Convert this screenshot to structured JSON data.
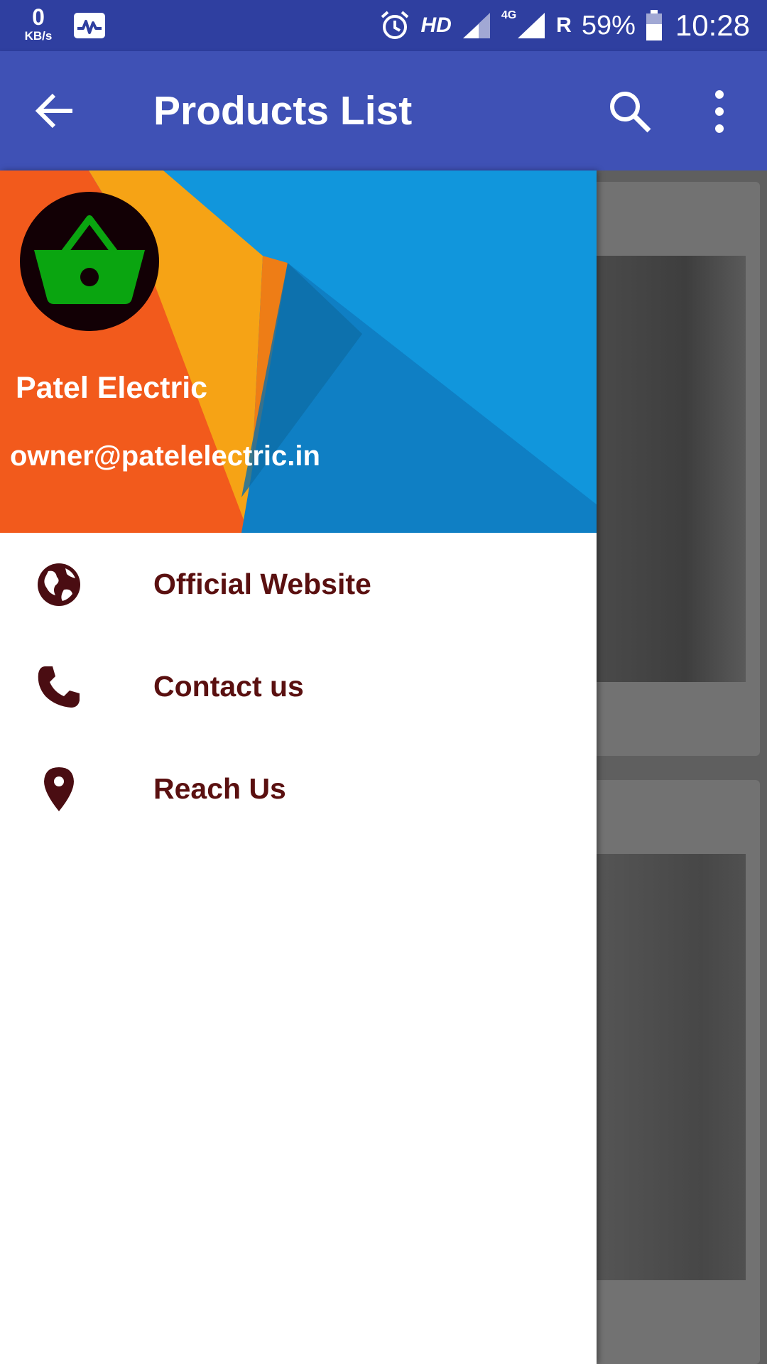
{
  "status_bar": {
    "net_speed_value": "0",
    "net_speed_unit": "KB/s",
    "hd_label": "HD",
    "network_label": "4G",
    "roaming_label": "R",
    "battery_percent": "59%",
    "time": "10:28",
    "icons": [
      "activity-monitor-icon",
      "alarm-icon",
      "signal-icon",
      "signal-4g-icon",
      "battery-icon"
    ]
  },
  "app_bar": {
    "title": "Products List",
    "icons": [
      "back-arrow-icon",
      "search-icon",
      "more-vert-icon"
    ]
  },
  "drawer": {
    "header": {
      "name": "Patel Electric",
      "email": "owner@patelelectric.in",
      "avatar_icon": "shopping-basket-icon"
    },
    "items": [
      {
        "label": "Official Website",
        "icon": "globe-icon"
      },
      {
        "label": "Contact us",
        "icon": "phone-icon"
      },
      {
        "label": "Reach Us",
        "icon": "location-pin-icon"
      }
    ]
  },
  "colors": {
    "status_bar": "#2f3fa0",
    "app_bar": "#3f51b5",
    "menu_text": "#5a1010",
    "basket_green": "#0aa510"
  }
}
